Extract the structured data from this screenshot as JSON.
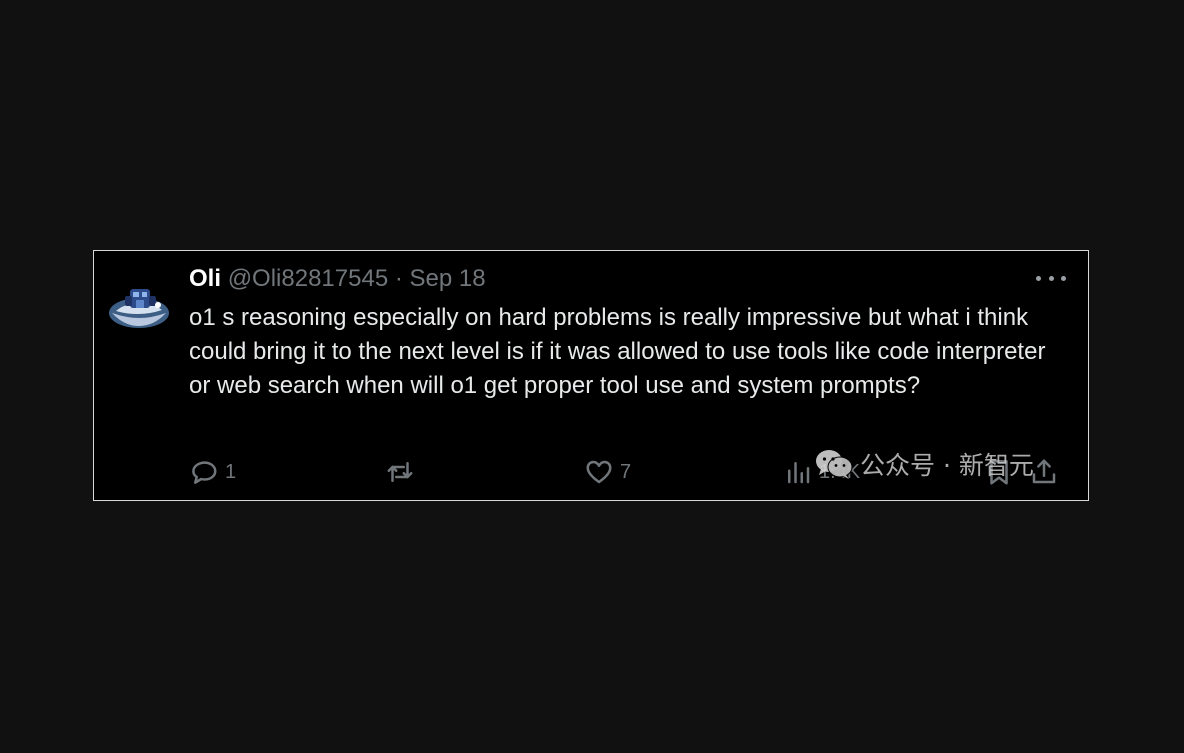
{
  "tweet": {
    "display_name": "Oli",
    "handle": "@Oli82817545",
    "separator": "·",
    "date": "Sep 18",
    "text": "o1 s reasoning especially on hard problems is really impressive but what i think could bring it to the next level is if it was allowed to use tools like code interpreter or web search when will o1 get proper tool use and system prompts?",
    "avatar_icon": "avatar-image",
    "more_icon": "more-dots-icon"
  },
  "actions": {
    "reply_count": "1",
    "retweet_count": "",
    "like_count": "7",
    "views_count": "1.4K",
    "icons": [
      "reply-icon",
      "retweet-icon",
      "like-icon",
      "views-icon",
      "bookmark-icon",
      "share-icon"
    ]
  },
  "watermark": {
    "text": "公众号 · 新智元",
    "icon": "wechat-icon"
  },
  "colors": {
    "background": "#111111",
    "card": "#000000",
    "text": "#e7e9ea",
    "muted": "#71767b"
  }
}
